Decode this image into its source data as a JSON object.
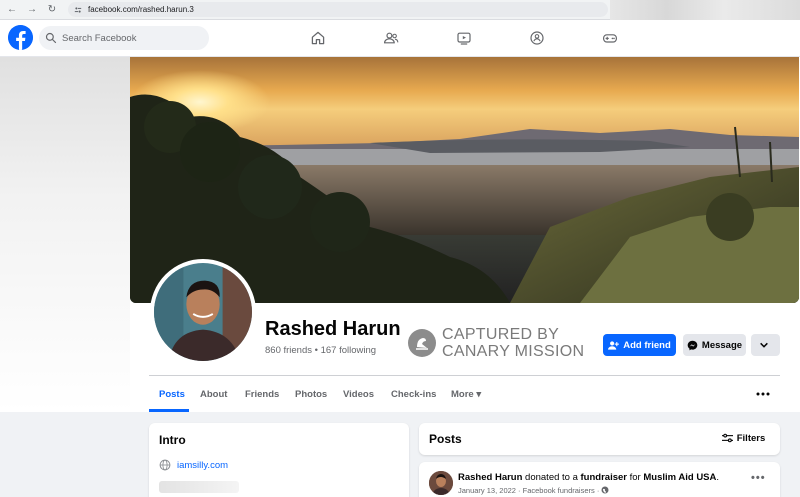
{
  "browser": {
    "url": "facebook.com/rashed.harun.3"
  },
  "search": {
    "placeholder": "Search Facebook"
  },
  "profile": {
    "name": "Rashed Harun",
    "stats": "860 friends • 167 following"
  },
  "watermark": {
    "line1": "CAPTURED BY",
    "line2": "CANARY MISSION"
  },
  "actions": {
    "add_friend": "Add friend",
    "message": "Message"
  },
  "tabs": [
    {
      "label": "Posts"
    },
    {
      "label": "About"
    },
    {
      "label": "Friends"
    },
    {
      "label": "Photos"
    },
    {
      "label": "Videos"
    },
    {
      "label": "Check-ins"
    },
    {
      "label": "More ▾"
    }
  ],
  "intro": {
    "title": "Intro",
    "link": "iamsilly.com"
  },
  "posts": {
    "title": "Posts",
    "filters_label": "Filters",
    "items": [
      {
        "author": "Rashed Harun",
        "verb1": " donated to a ",
        "object": "fundraiser",
        "verb2": " for ",
        "target": "Muslim Aid USA",
        "end": ".",
        "meta": "January 13, 2022 · Facebook fundraisers ·"
      }
    ]
  },
  "colors": {
    "brand": "#0866ff",
    "secondary_button": "#e4e6eb",
    "background": "#f0f2f5"
  }
}
